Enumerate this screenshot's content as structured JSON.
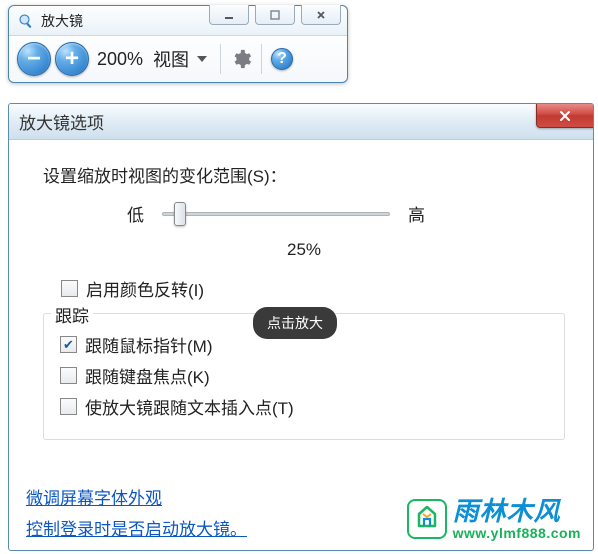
{
  "magnifier": {
    "title": "放大镜",
    "zoom_value": "200%",
    "view_label": "视图",
    "minus": "−",
    "plus": "+",
    "help": "?"
  },
  "options": {
    "title": "放大镜选项",
    "scale_label": "设置缩放时视图的变化范围(S)：",
    "low_label": "低",
    "high_label": "高",
    "slider_value": "25%",
    "invert_label": "启用颜色反转(I)",
    "tooltip": "点击放大",
    "track_legend": "跟踪",
    "track_mouse": "跟随鼠标指针(M)",
    "track_keyboard": "跟随键盘焦点(K)",
    "track_textinsert": "使放大镜跟随文本插入点(T)",
    "link_font": "微调屏幕字体外观",
    "link_login": "控制登录时是否启动放大镜。"
  },
  "watermark": {
    "brand_cn": "雨林木风",
    "brand_url": "www.ylmf888.com"
  }
}
